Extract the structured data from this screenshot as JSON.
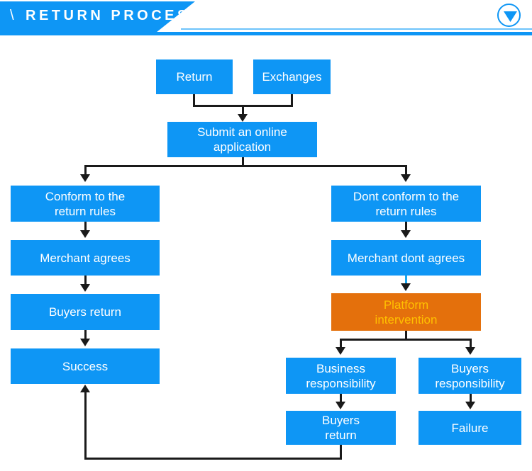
{
  "header": {
    "slash": "\\",
    "title": "RETURN PROCESS",
    "toggle_icon": "chevron-down-icon",
    "accent_color": "#0E96F5",
    "rule_color": "#6EC4FB"
  },
  "theme": {
    "box_fill": "#0E96F5",
    "box_text": "#FFFFFF",
    "highlight_fill": "#E4700C",
    "highlight_text": "#FFC000",
    "connector": "#1A1A1A",
    "connector_highlight": "#18A7F0",
    "background": "#FFFFFF"
  },
  "flowchart": {
    "title": "RETURN PROCESS",
    "nodes": [
      {
        "id": "return",
        "label": "Return",
        "style": "blue"
      },
      {
        "id": "exchanges",
        "label": "Exchanges",
        "style": "blue"
      },
      {
        "id": "submit",
        "label": "Submit an online application",
        "style": "blue"
      },
      {
        "id": "conform",
        "label": "Conform to the return rules",
        "style": "blue"
      },
      {
        "id": "merchant-agrees",
        "label": "Merchant agrees",
        "style": "blue"
      },
      {
        "id": "buyers-return-left",
        "label": "Buyers return",
        "style": "blue"
      },
      {
        "id": "success",
        "label": "Success",
        "style": "blue"
      },
      {
        "id": "dont-conform",
        "label": "Dont conform to the return rules",
        "style": "blue"
      },
      {
        "id": "merchant-dont",
        "label": "Merchant dont agrees",
        "style": "blue"
      },
      {
        "id": "platform",
        "label": "Platform intervention",
        "style": "orange"
      },
      {
        "id": "business-resp",
        "label": "Business responsibility",
        "style": "blue"
      },
      {
        "id": "buyers-resp",
        "label": "Buyers responsibility",
        "style": "blue"
      },
      {
        "id": "buyers-return-right",
        "label": "Buyers return",
        "style": "blue"
      },
      {
        "id": "failure",
        "label": "Failure",
        "style": "blue"
      }
    ],
    "edges": [
      {
        "from": "return",
        "to": "submit"
      },
      {
        "from": "exchanges",
        "to": "submit"
      },
      {
        "from": "submit",
        "to": "conform"
      },
      {
        "from": "submit",
        "to": "dont-conform"
      },
      {
        "from": "conform",
        "to": "merchant-agrees"
      },
      {
        "from": "merchant-agrees",
        "to": "buyers-return-left"
      },
      {
        "from": "buyers-return-left",
        "to": "success"
      },
      {
        "from": "dont-conform",
        "to": "merchant-dont"
      },
      {
        "from": "merchant-dont",
        "to": "platform",
        "style": "highlight"
      },
      {
        "from": "platform",
        "to": "business-resp"
      },
      {
        "from": "platform",
        "to": "buyers-resp"
      },
      {
        "from": "business-resp",
        "to": "buyers-return-right"
      },
      {
        "from": "buyers-resp",
        "to": "failure"
      },
      {
        "from": "buyers-return-right",
        "to": "success"
      }
    ]
  },
  "labels": {
    "return": "Return",
    "exchanges": "Exchanges",
    "submit_line1": "Submit an online",
    "submit_line2": "application",
    "conform_line1": "Conform to the",
    "conform_line2": "return rules",
    "merchant_agrees": "Merchant agrees",
    "buyers_return_left": "Buyers return",
    "success": "Success",
    "dont_conform_line1": "Dont conform to the",
    "dont_conform_line2": "return rules",
    "merchant_dont_agrees": "Merchant dont agrees",
    "platform_line1": "Platform",
    "platform_line2": "intervention",
    "business_resp_line1": "Business",
    "business_resp_line2": "responsibility",
    "buyers_resp_line1": "Buyers",
    "buyers_resp_line2": "responsibility",
    "buyers_return_right_line1": "Buyers",
    "buyers_return_right_line2": "return",
    "failure": "Failure"
  }
}
